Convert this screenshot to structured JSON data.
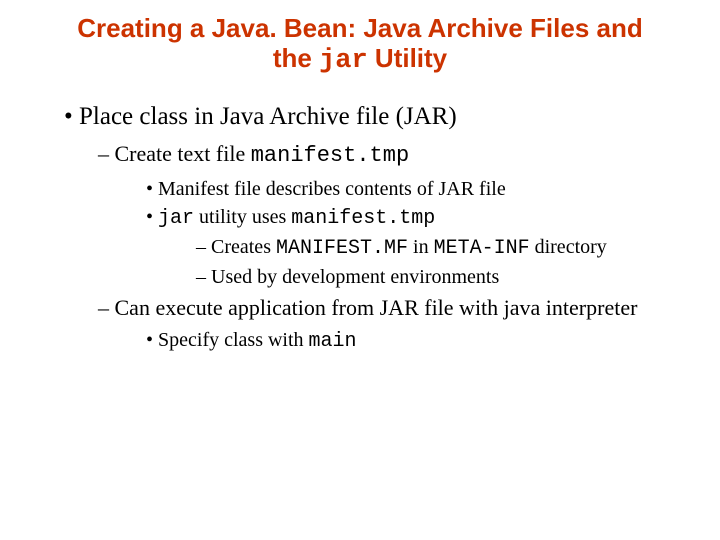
{
  "title": {
    "line1": "Creating a Java. Bean: Java Archive Files and",
    "line2_pre": "the ",
    "line2_mono": "jar",
    "line2_post": " Utility"
  },
  "b1": "Place class in Java Archive file (JAR)",
  "b2a_pre": "Create text file ",
  "b2a_mono": "manifest.tmp",
  "b3a": "Manifest file describes contents of JAR file",
  "b3b_mono1": "jar",
  "b3b_mid": " utility uses ",
  "b3b_mono2": "manifest.tmp",
  "b4a_pre": "Creates ",
  "b4a_mono1": "MANIFEST.MF",
  "b4a_mid": " in ",
  "b4a_mono2": "META-INF",
  "b4a_post": " directory",
  "b4b": "Used by development environments",
  "b2b": "Can execute application from JAR file with java interpreter",
  "b3c_pre": "Specify class with ",
  "b3c_mono": "main"
}
